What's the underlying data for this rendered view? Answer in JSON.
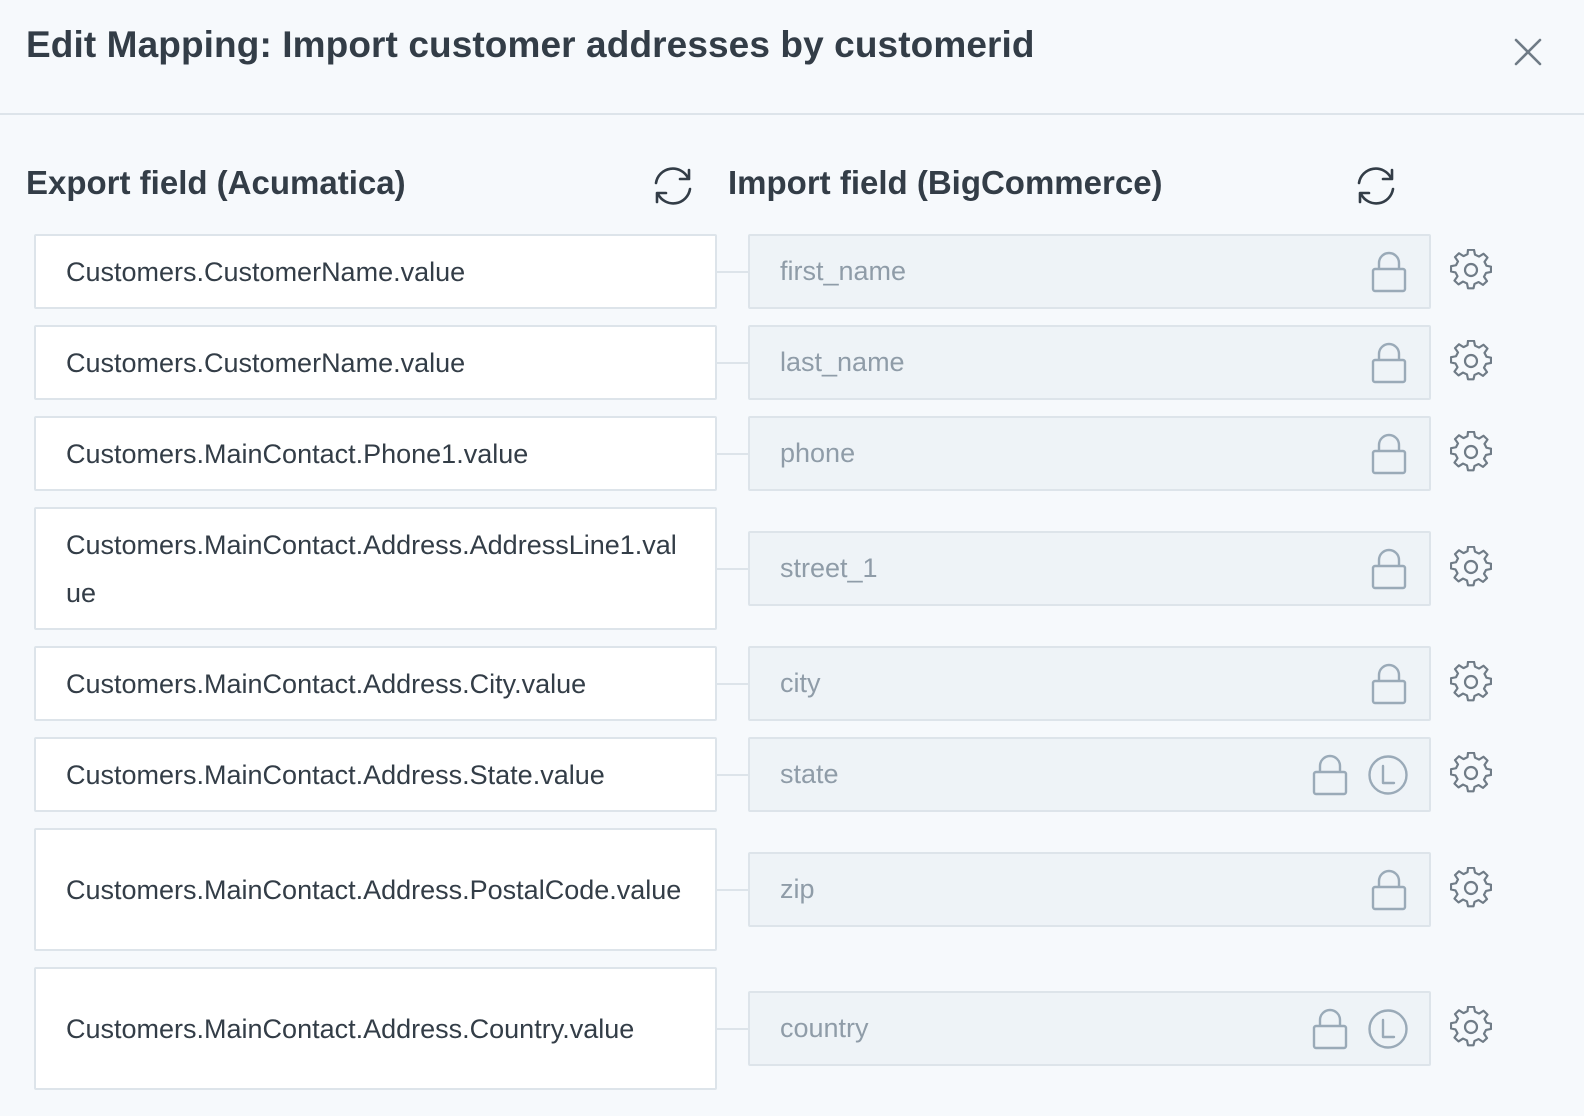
{
  "dialog": {
    "title": "Edit Mapping: Import customer addresses by customerid"
  },
  "columns": {
    "export_header": "Export field (Acumatica)",
    "import_header": "Import field (BigCommerce)"
  },
  "colors": {
    "text": "#333d47",
    "muted_text": "#8f9ca8",
    "border": "#dde4ea",
    "icon": "#9aaab8",
    "import_bg": "#eef3f7"
  },
  "mappings": [
    {
      "export": "Customers.CustomerName.value",
      "import": "first_name",
      "locked": true,
      "lookup": false
    },
    {
      "export": "Customers.CustomerName.value",
      "import": "last_name",
      "locked": true,
      "lookup": false
    },
    {
      "export": "Customers.MainContact.Phone1.value",
      "import": "phone",
      "locked": true,
      "lookup": false
    },
    {
      "export": "Customers.MainContact.Address.AddressLine1.value",
      "import": "street_1",
      "locked": true,
      "lookup": false
    },
    {
      "export": "Customers.MainContact.Address.City.value",
      "import": "city",
      "locked": true,
      "lookup": false
    },
    {
      "export": "Customers.MainContact.Address.State.value",
      "import": "state",
      "locked": true,
      "lookup": true
    },
    {
      "export": "Customers.MainContact.Address.PostalCode.value",
      "import": "zip",
      "locked": true,
      "lookup": false
    },
    {
      "export": "Customers.MainContact.Address.Country.value",
      "import": "country",
      "locked": true,
      "lookup": true
    }
  ],
  "icons": {
    "close": "close-icon",
    "refresh": "refresh-icon",
    "lock": "lock-icon",
    "lookup": "lookup-icon",
    "settings": "gear-icon"
  }
}
